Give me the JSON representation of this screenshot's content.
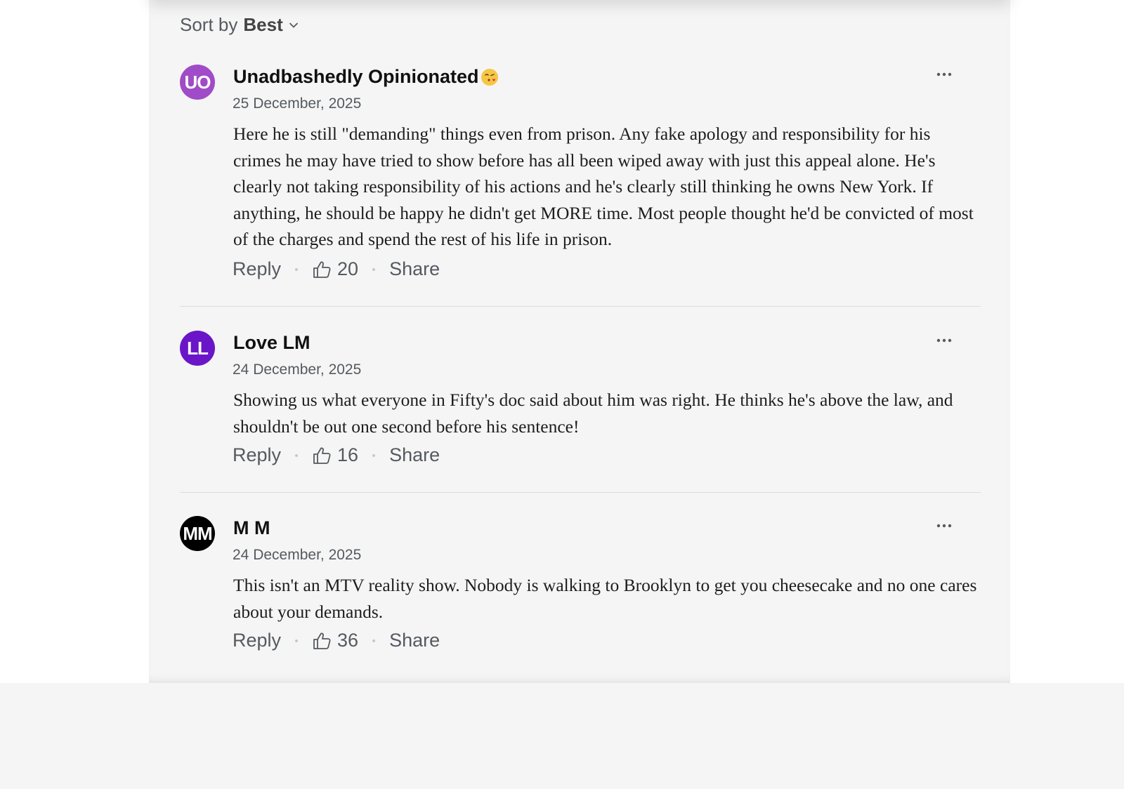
{
  "sort": {
    "label": "Sort by",
    "value": "Best"
  },
  "comments": [
    {
      "initials": "UO",
      "avatar_color": "#a04bc7",
      "author": "Unadbashedly Opinionated",
      "author_emoji": "kissing-face-emoji",
      "date": "25 December, 2025",
      "text": "Here he is still \"demanding\" things even from prison. Any fake apology and responsibility for his crimes he may have tried to show before has all been wiped away with just this appeal alone. He's clearly not taking responsibility of his actions and he's clearly still thinking he owns New York. If anything, he should be happy he didn't get MORE time. Most people thought he'd be convicted of most of the charges and spend the rest of his life in prison.",
      "reply_label": "Reply",
      "likes": "20",
      "share_label": "Share"
    },
    {
      "initials": "LL",
      "avatar_color": "#6a16c8",
      "author": "Love LM",
      "date": "24 December, 2025",
      "text": "Showing us what everyone in Fifty's doc said about him was right. He thinks he's above the law, and shouldn't be out one second before his sentence!",
      "reply_label": "Reply",
      "likes": "16",
      "share_label": "Share"
    },
    {
      "initials": "MM",
      "avatar_color": "#000000",
      "author": "M M",
      "date": "24 December, 2025",
      "text": "This isn't an MTV reality show. Nobody is walking to Brooklyn to get you cheesecake and no one cares about your demands.",
      "reply_label": "Reply",
      "likes": "36",
      "share_label": "Share"
    }
  ]
}
